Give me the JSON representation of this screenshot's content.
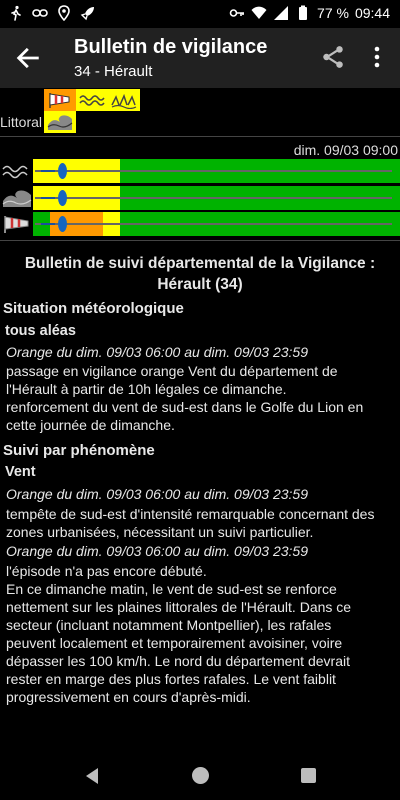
{
  "status_bar": {
    "icons_left": [
      "walk-icon",
      "link-icon",
      "location-icon",
      "rocket-icon"
    ],
    "icons_right": [
      "key-icon",
      "wifi-icon",
      "signal-icon",
      "battery-icon"
    ],
    "battery": "77 %",
    "time": "09:44"
  },
  "app_bar": {
    "title": "Bulletin de vigilance",
    "subtitle": "34 - Hérault"
  },
  "vigilance_icons": [
    "wind-sock-icon",
    "waves-icon",
    "surf-waves-icon"
  ],
  "littoral": {
    "label": "Littoral",
    "icon": "coastal-wave-icon"
  },
  "timeline": {
    "date_label": "dim. 09/03 09:00",
    "colors": {
      "yellow": "#ffff00",
      "green": "#00b300",
      "orange": "#ff9900"
    },
    "rows": [
      {
        "icon": "waves-icon",
        "segments": [
          {
            "color": "yellow",
            "fraction": 0.237
          },
          {
            "color": "green",
            "fraction": 0.763
          }
        ]
      },
      {
        "icon": "coastal-wave-icon",
        "segments": [
          {
            "color": "yellow",
            "fraction": 0.237
          },
          {
            "color": "green",
            "fraction": 0.763
          }
        ]
      },
      {
        "icon": "wind-sock-icon",
        "segments": [
          {
            "color": "green",
            "fraction": 0.046
          },
          {
            "color": "orange",
            "fraction": 0.144
          },
          {
            "color": "yellow",
            "fraction": 0.047
          },
          {
            "color": "green",
            "fraction": 0.763
          }
        ]
      }
    ]
  },
  "bulletin": {
    "title_line1": "Bulletin de suivi départemental de la Vigilance :",
    "title_line2": "Hérault (34)",
    "situation_heading": "Situation météorologique",
    "tous_aleas_heading": "tous aléas",
    "tous_aleas_period": "Orange du dim. 09/03 06:00 au dim. 09/03 23:59",
    "tous_aleas_lines": [
      "passage en vigilance orange Vent du département de",
      "l'Hérault à partir de 10h légales ce dimanche.",
      "renforcement du vent de sud-est dans le Golfe du Lion en",
      "cette journée de dimanche."
    ],
    "suivi_heading": "Suivi par phénomène",
    "vent_heading": "Vent",
    "vent_period_1": "Orange du dim. 09/03 06:00 au dim. 09/03 23:59",
    "vent_lines_1": [
      "tempête de sud-est d'intensité remarquable concernant des",
      "zones urbanisées, nécessitant un suivi particulier."
    ],
    "vent_period_2": "Orange du dim. 09/03 06:00 au dim. 09/03 23:59",
    "vent_lines_2": [
      "l'épisode n'a pas encore débuté.",
      "En ce dimanche matin, le vent de sud-est se renforce",
      "nettement sur les plaines littorales de l'Hérault. Dans ce",
      "secteur (incluant notamment Montpellier), les rafales",
      "peuvent localement et temporairement avoisiner, voire",
      "dépasser les 100 km/h. Le nord du département devrait",
      "rester en marge des plus fortes rafales. Le vent faiblit",
      "progressivement en cours d'après-midi."
    ]
  },
  "nav_bar": {
    "icons": [
      "nav-back-icon",
      "nav-home-icon",
      "nav-recents-icon"
    ]
  }
}
